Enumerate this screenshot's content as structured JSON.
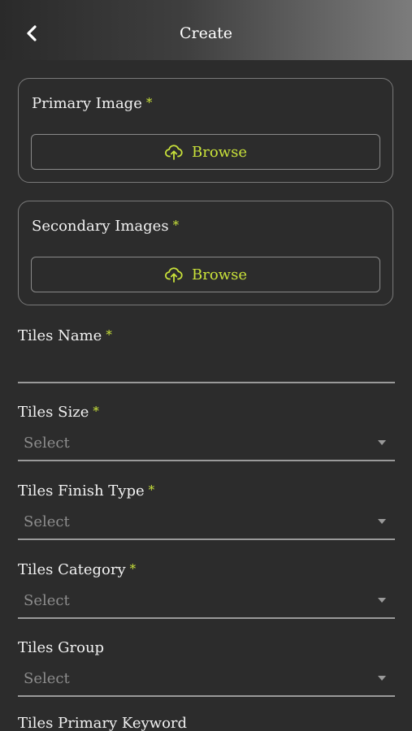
{
  "header": {
    "title": "Create",
    "back_icon": "chevron-left-icon"
  },
  "primary_image": {
    "label": "Primary Image",
    "required_mark": "*",
    "button_label": "Browse",
    "button_icon": "cloud-upload-icon"
  },
  "secondary_images": {
    "label": "Secondary Images",
    "required_mark": "*",
    "button_label": "Browse",
    "button_icon": "cloud-upload-icon"
  },
  "fields": {
    "tiles_name": {
      "label": "Tiles Name",
      "required_mark": "*",
      "value": ""
    },
    "tiles_size": {
      "label": "Tiles Size",
      "required_mark": "*",
      "value": "Select"
    },
    "tiles_finish_type": {
      "label": "Tiles Finish Type",
      "required_mark": "*",
      "value": "Select"
    },
    "tiles_category": {
      "label": "Tiles Category",
      "required_mark": "*",
      "value": "Select"
    },
    "tiles_group": {
      "label": "Tiles Group",
      "value": "Select"
    },
    "tiles_primary_keyword": {
      "label": "Tiles Primary Keyword"
    }
  },
  "colors": {
    "accent": "#c9e23a",
    "background": "#2c2c2c",
    "border": "#7a7a7a",
    "placeholder": "#8d8d8d"
  }
}
